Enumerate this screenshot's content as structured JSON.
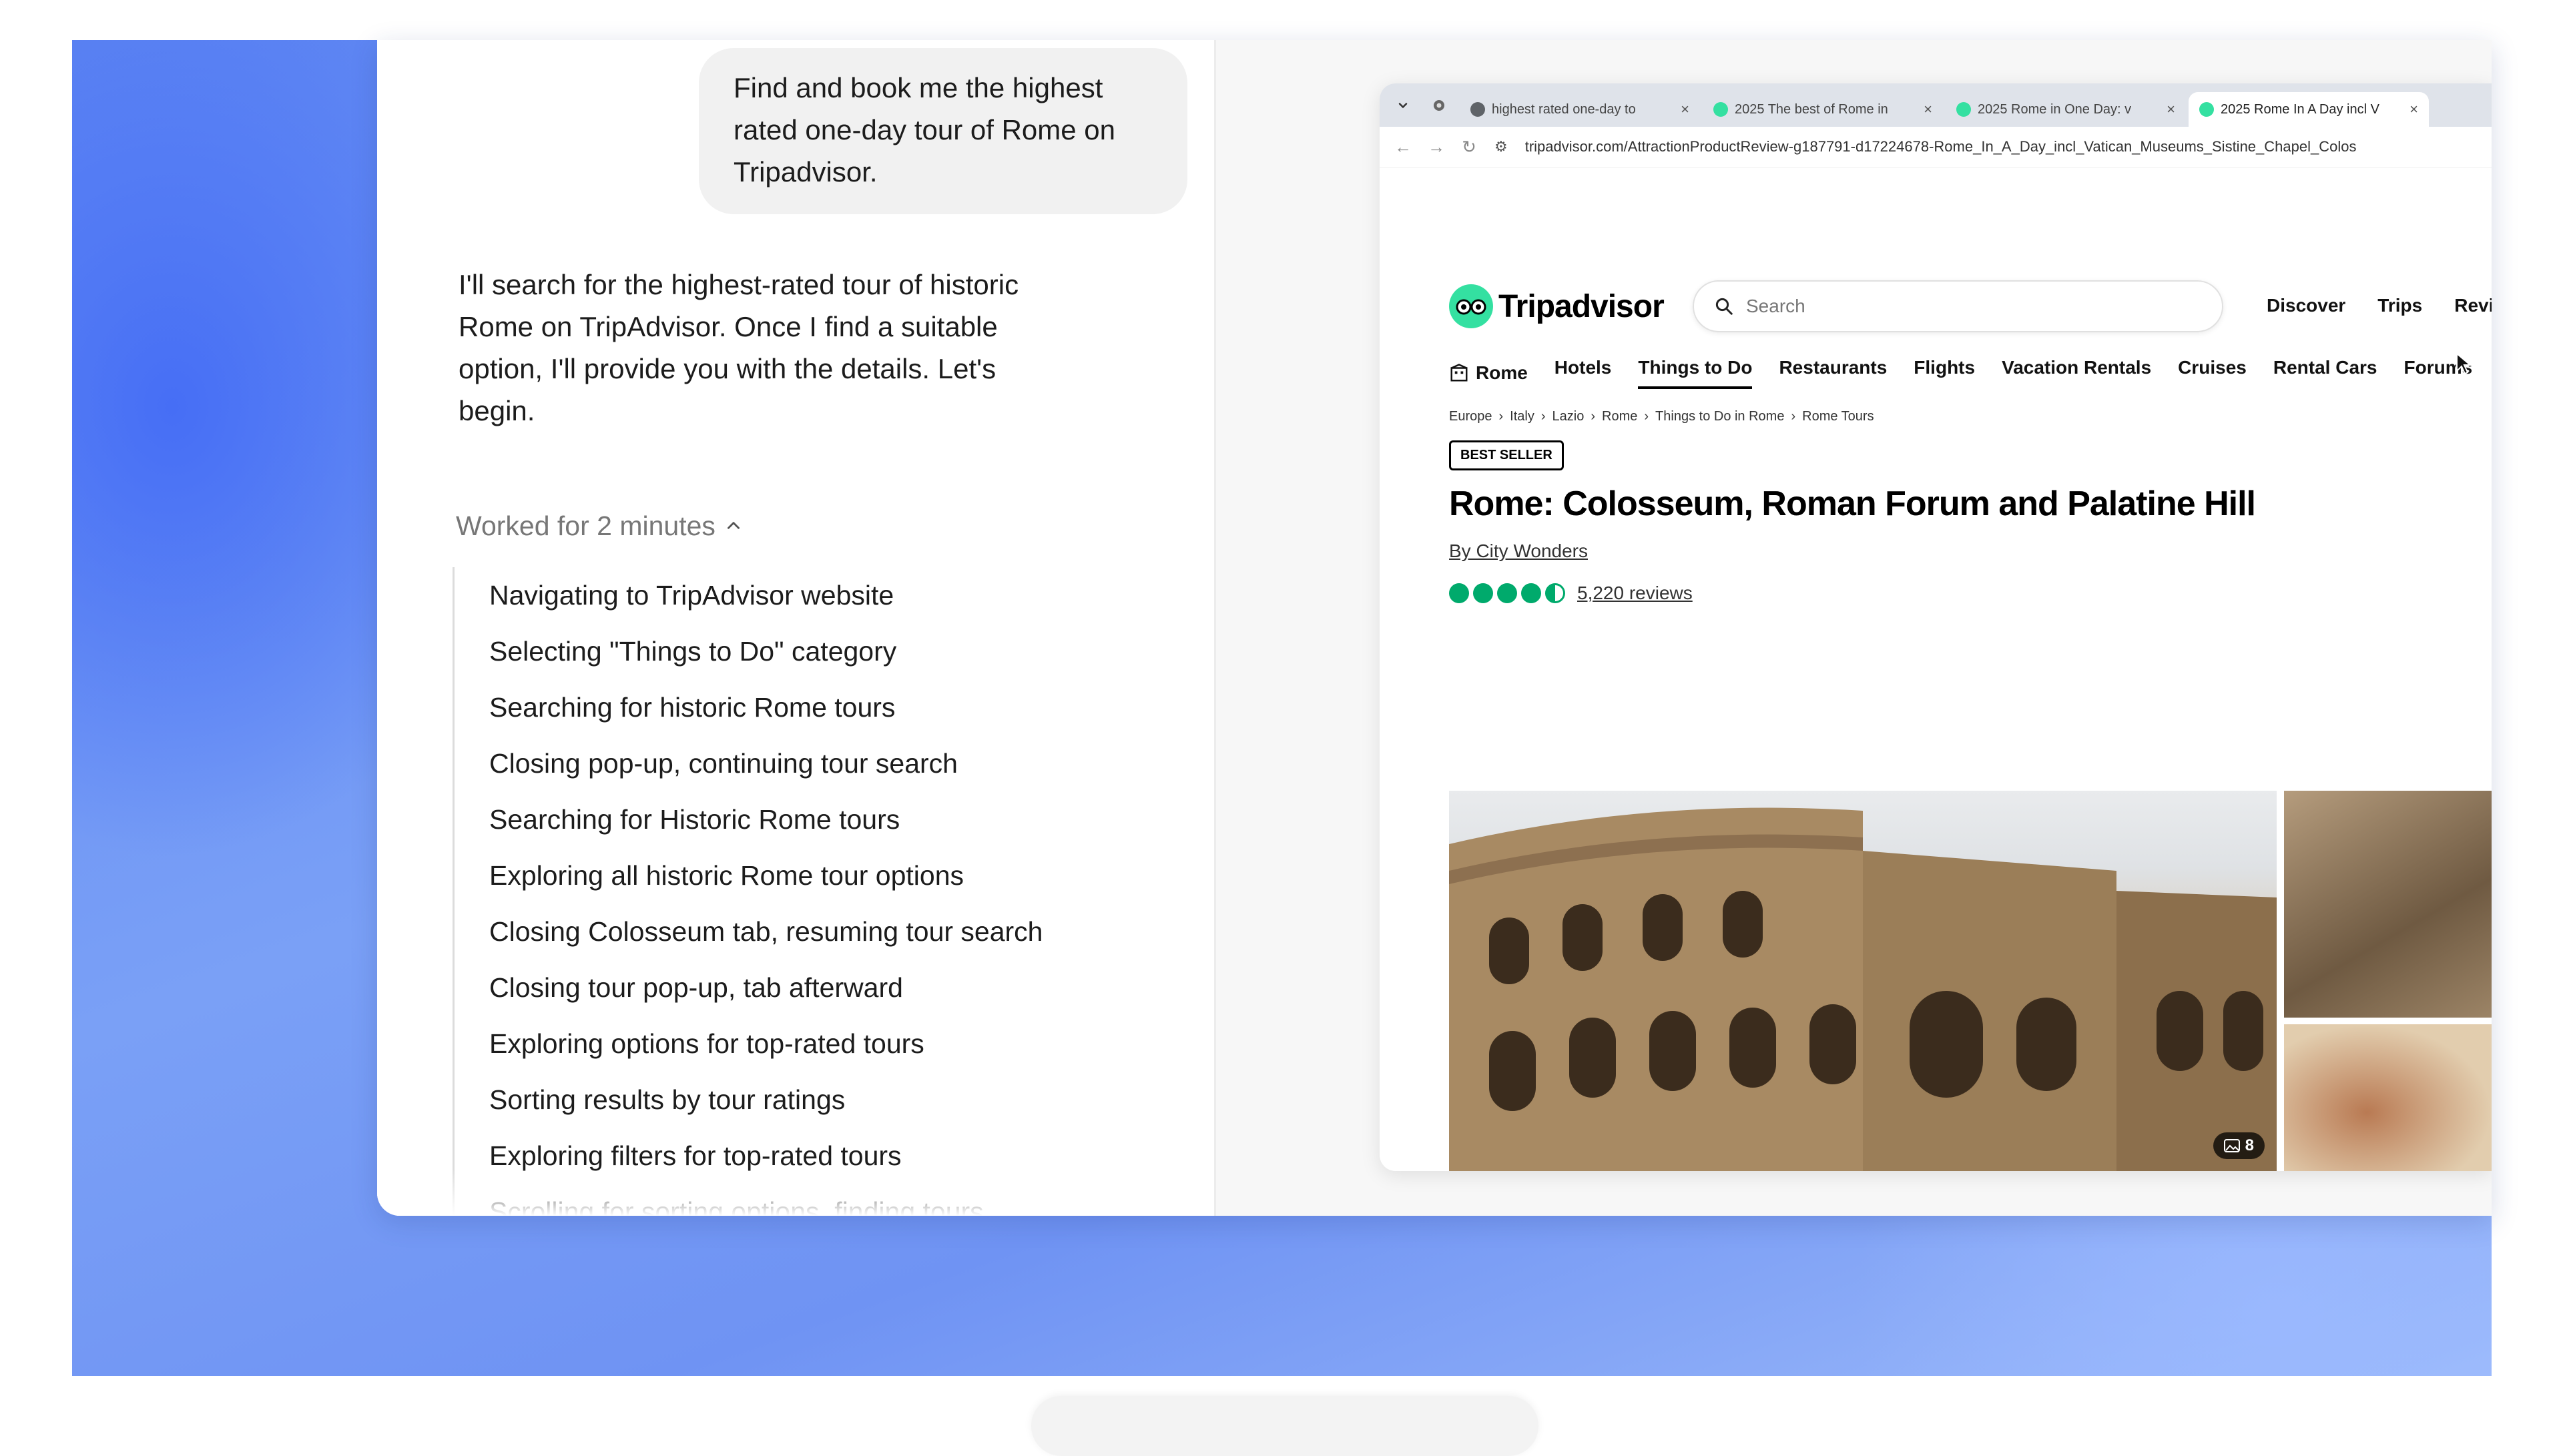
{
  "chat": {
    "user_message": "Find and book me the highest rated one-day tour of Rome on Tripadvisor.",
    "assistant_message": "I'll search for the highest-rated tour of historic Rome on TripAdvisor. Once I find a suitable option, I'll provide you with the details. Let's begin.",
    "worked_label": "Worked for 2 minutes",
    "steps": [
      "Navigating to TripAdvisor website",
      "Selecting \"Things to Do\" category",
      "Searching for historic Rome tours",
      "Closing pop-up, continuing tour search",
      "Searching for Historic Rome tours",
      "Exploring all historic Rome tour options",
      "Closing Colosseum tab, resuming tour search",
      "Closing tour pop-up, tab afterward",
      "Exploring options for top-rated tours",
      "Sorting results by tour ratings",
      "Exploring filters for top-rated tours",
      "Scrolling for sorting options, finding tours"
    ]
  },
  "browser": {
    "tabs": [
      {
        "label": "highest rated one-day to",
        "icon": "search-icon",
        "color": "#5f6368"
      },
      {
        "label": "2025 The best of Rome in",
        "icon": "tripadvisor-icon",
        "color": "#34e0a1"
      },
      {
        "label": "2025 Rome in One Day: v",
        "icon": "tripadvisor-icon",
        "color": "#34e0a1"
      },
      {
        "label": "2025 Rome In A Day incl V",
        "icon": "tripadvisor-icon",
        "color": "#34e0a1",
        "active": true
      }
    ],
    "url": "tripadvisor.com/AttractionProductReview-g187791-d17224678-Rome_In_A_Day_incl_Vatican_Museums_Sistine_Chapel_Colos"
  },
  "tripadvisor": {
    "brand": "Tripadvisor",
    "search_placeholder": "Search",
    "top_links": [
      "Discover",
      "Trips",
      "Review"
    ],
    "nav": {
      "rome": "Rome",
      "items": [
        "Hotels",
        "Things to Do",
        "Restaurants",
        "Flights",
        "Vacation Rentals",
        "Cruises",
        "Rental Cars",
        "Forums"
      ]
    },
    "breadcrumb": [
      "Europe",
      "Italy",
      "Lazio",
      "Rome",
      "Things to Do in Rome",
      "Rome Tours"
    ],
    "badge": "BEST SELLER",
    "title": "Rome: Colosseum, Roman Forum and Palatine Hill",
    "by": "By City Wonders",
    "rating": 4.5,
    "reviews": "5,220 reviews",
    "photo_count": "8"
  },
  "colors": {
    "accent_green": "#00aa6c",
    "brand_green": "#34e0a1",
    "backdrop_blue": "#5b83f2"
  }
}
